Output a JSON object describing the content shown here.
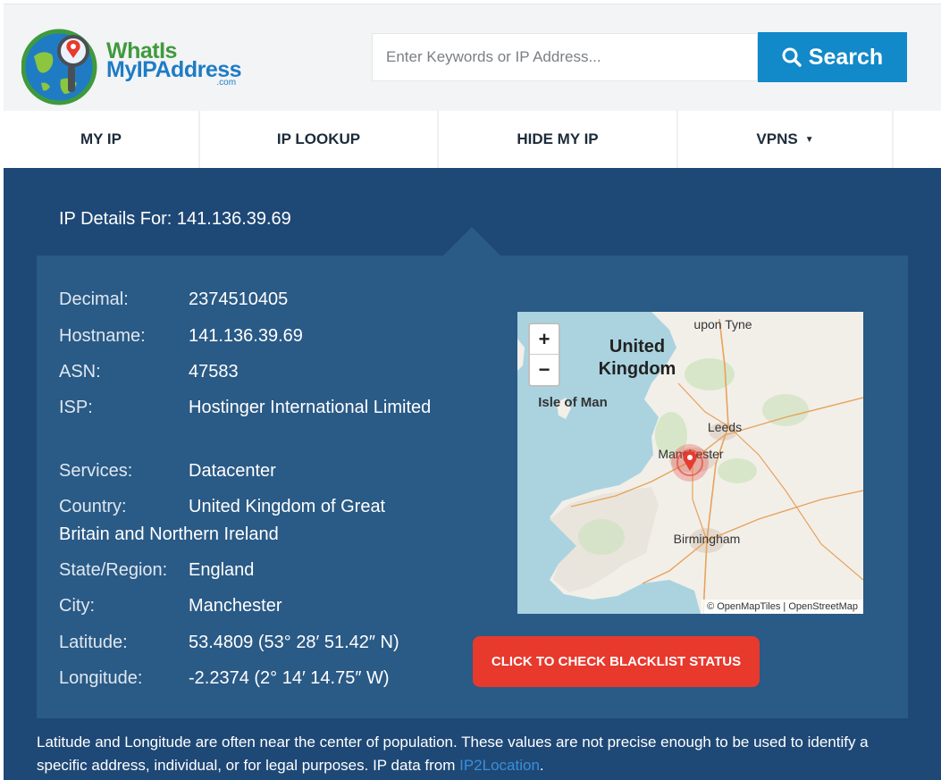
{
  "header": {
    "logo": {
      "line1": "WhatIs",
      "line2": "MyIPAddress",
      "line3": ".com"
    },
    "search": {
      "placeholder": "Enter Keywords or IP Address...",
      "button_label": "Search"
    }
  },
  "nav": {
    "items": [
      {
        "label": "MY IP"
      },
      {
        "label": "IP LOOKUP"
      },
      {
        "label": "HIDE MY IP"
      },
      {
        "label": "VPNS",
        "has_dropdown": true,
        "caret": "▼"
      }
    ]
  },
  "details": {
    "title": "IP Details For: 141.136.39.69",
    "rows": [
      {
        "key": "Decimal:",
        "value": "2374510405"
      },
      {
        "key": "Hostname:",
        "value": "141.136.39.69"
      },
      {
        "key": "ASN:",
        "value": "47583"
      },
      {
        "key": "ISP:",
        "value": "Hostinger International Limited"
      },
      {
        "key": "Services:",
        "value": "Datacenter"
      },
      {
        "key": "Country:",
        "value": "United Kingdom of Great Britain and Northern Ireland"
      },
      {
        "key": "State/Region:",
        "value": "England"
      },
      {
        "key": "City:",
        "value": "Manchester"
      },
      {
        "key": "Latitude:",
        "value": "53.4809 (53° 28′ 51.42″ N)"
      },
      {
        "key": "Longitude:",
        "value": "-2.2374 (2° 14′ 14.75″ W)"
      }
    ]
  },
  "map": {
    "zoom_in": "+",
    "zoom_out": "−",
    "labels": {
      "top": "upon Tyne",
      "country": "United Kingdom",
      "isle": "Isle of Man",
      "leeds": "Leeds",
      "manchester": "Manchester",
      "birmingham": "Birmingham"
    },
    "attribution": "© OpenMapTiles | OpenStreetMap",
    "colors": {
      "sea": "#aad3df",
      "land": "#f2efe9",
      "marker": "#e63b2e"
    }
  },
  "blacklist_button": {
    "label": "CLICK TO CHECK BLACKLIST STATUS"
  },
  "note": {
    "text": "Latitude and Longitude are often near the center of population. These values are not precise enough to be used to identify a specific address, individual, or for legal purposes. IP data from ",
    "link": "IP2Location",
    "end": "."
  },
  "colors": {
    "brand_blue": "#1289c9",
    "main_bg": "#1e4876",
    "panel_bg": "#2a5a86",
    "alert_red": "#e8392d"
  }
}
